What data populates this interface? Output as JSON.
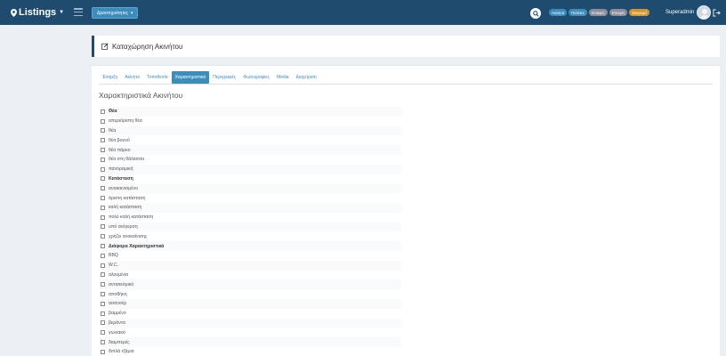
{
  "app": {
    "logo_text": "Listings"
  },
  "header": {
    "actions_label": "Δραστηριότητες",
    "pills": [
      {
        "label": "Ακίνητα",
        "color": "#3c8dbc"
      },
      {
        "label": "Πελάτες",
        "color": "#3c8dbc"
      },
      {
        "label": "Επαφές",
        "color": "#8c8c9b"
      },
      {
        "label": "Επαφές",
        "color": "#8c8c9b"
      },
      {
        "label": "Εκκρεμεί",
        "color": "#d4952e"
      }
    ],
    "user_name": "Superadmin"
  },
  "page": {
    "title": "Καταχώρηση Ακινήτου"
  },
  "tabs": [
    {
      "label": "Έναρξη"
    },
    {
      "label": "Ακίνητο"
    },
    {
      "label": "Τοποθεσία"
    },
    {
      "label": "Χαρακτηριστικά",
      "active": true
    },
    {
      "label": "Περιγραφές"
    },
    {
      "label": "Φωτογραφίες"
    },
    {
      "label": "Media"
    },
    {
      "label": "Διαχείριση"
    }
  ],
  "section_title": "Χαρακτηριστικά Ακινήτου",
  "features": [
    {
      "label": "Θέα",
      "group": true
    },
    {
      "label": "απεριόριστη θέα"
    },
    {
      "label": "θέα"
    },
    {
      "label": "θέα βουνό"
    },
    {
      "label": "θέα πάρκο"
    },
    {
      "label": "θέα στη θάλασσα"
    },
    {
      "label": "πανοραμική"
    },
    {
      "label": "Κατάσταση",
      "group": true
    },
    {
      "label": "ανακαινισμένο"
    },
    {
      "label": "άριστη κατάσταση"
    },
    {
      "label": "καλή κατάσταση"
    },
    {
      "label": "πολύ καλή κατάσταση"
    },
    {
      "label": "υπό ανέγερση"
    },
    {
      "label": "χρήζει ανακαίνισης"
    },
    {
      "label": "Διάφορα Χαρακτηριστικά",
      "group": true
    },
    {
      "label": "BBQ"
    },
    {
      "label": "W.C."
    },
    {
      "label": "αλουμίνια"
    },
    {
      "label": "αντισεισμικό"
    },
    {
      "label": "αποθήκη"
    },
    {
      "label": "ασανσέρ"
    },
    {
      "label": "βαμμένο"
    },
    {
      "label": "βεράντα"
    },
    {
      "label": "γωνιακό"
    },
    {
      "label": "διαμπερές"
    },
    {
      "label": "διπλά τζάμια"
    }
  ]
}
